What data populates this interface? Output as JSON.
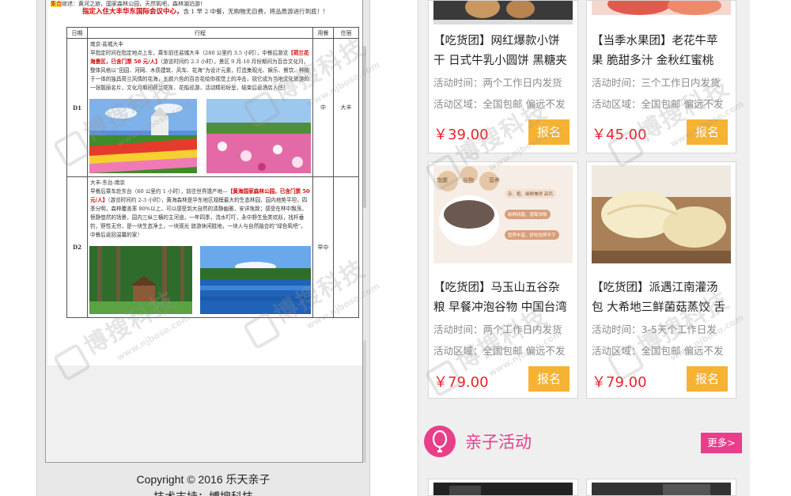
{
  "left": {
    "intro_line": "综述：黄河之旅，国家森林公园，天然氧吧，森林湖泊游！",
    "intro_highlight": "集合",
    "intro_bold": "指定入住大丰华东国际会议中心，",
    "intro_tail": "含 1 早 2 中餐，无购物无自费，将品质游进行到底！!",
    "table": {
      "headers": [
        "日期",
        "行程",
        "用餐",
        "住宿"
      ],
      "rows": [
        {
          "day": "D1",
          "route": "南京-盐城大丰",
          "text_a": "早指定时间在指定地点上车，乘车前往盐城大丰（280 公里约 3.5 小时），中餐后游览",
          "text_red": "【荷兰花海景区，已含门票 50 元/人】",
          "text_b": "（游览时间约 2-3 小时），景区 9 月-10 月份期间为百合文化月，整体风格以“田园、河网、木质建筑、风车、花海”为设计元素，打造集观光、娱乐、餐饮、种植于一体的独具荷兰风情的花海，五颜六色的百合花给你视觉上的冲击，锐它成为当地文化旅游的一张靓丽名片，文化月期间荷兰花车、花船巡游，活动精彩纷呈，结束后返酒店入住！",
          "meal": "中",
          "stay": "大丰"
        },
        {
          "day": "D2",
          "route": "大丰-东台-南京",
          "text_a": "早餐后乘车赴东台（60 公里约 1 小时），前往世界遗产地—",
          "text_red": "【黄海国家森林公园，已含门票 50 元/人】",
          "text_b": "（游览时间约 2-3 小时），黄海森林是华东地区规模最大的生态林园，园内地势平坦，四季分明，森林覆盖率 80%以上，可以感受到大自然的清静幽雅，安详逸致；感受在林中飘荡，惬静悠然的场景，园内三纵三横的主河道，一年四季，流水叮叮，永中野生鱼类欢跃，找杆垂钓，野性无穷，是一块生态净土，一块观光 旅游休闲胜地，一块人与自然融合的“绿色氧吧”，中餐后返回温馨的家！",
          "meal": "早中",
          "stay": ""
        }
      ]
    },
    "footer_copyright": "Copyright © 2016 乐天亲子",
    "footer_support": "技术支持：博搜科技"
  },
  "right": {
    "cards": [
      {
        "title1": "【吃货团】网红爆款小饼",
        "title2": "干 日式牛乳小圆饼 黑糖夹",
        "time": "活动时间：两个工作日内发货",
        "area": "活动区域：全国包邮 偏远不发",
        "price": "￥39.00",
        "button": "报名"
      },
      {
        "title1": "【当季水果团】老花牛苹",
        "title2": "果 脆甜多汁 金秋红蜜桃",
        "time": "活动时间：三个工作日内发货",
        "area": "活动区域：全国包邮 偏远不发",
        "price": "￥45.00",
        "button": "报名"
      },
      {
        "title1": "【吃货团】马玉山五谷杂",
        "title2": "粮 早餐冲泡谷物 中国台湾",
        "time": "活动时间：两个工作日内发货",
        "area": "活动区域：全国包邮 偏远不发",
        "price": "￥79.00",
        "button": "报名",
        "tags": [
          "饱腹",
          "谷物",
          "营养"
        ],
        "features": [
          "杂、粗、细粮兼得 高钙",
          "新鲜研磨、香醇浓郁",
          "营养丰富，好吃到停不下"
        ]
      },
      {
        "title1": "【吃货团】派遇江南灌汤",
        "title2": "包 大希地三鲜菌菇蒸饺 舌",
        "time": "活动时间：3-5天个工作日发",
        "area": "活动区域：全国包邮 偏远不发",
        "price": "￥79.00",
        "button": "报名"
      }
    ],
    "section_title": "亲子活动",
    "more_label": "更多>"
  },
  "watermark": {
    "text": "博搜科技",
    "url": "www.njboso.com"
  },
  "colors": {
    "price": "#e9232b",
    "button": "#f6b233",
    "accent": "#e83f8a",
    "doc_red": "#d40000"
  }
}
